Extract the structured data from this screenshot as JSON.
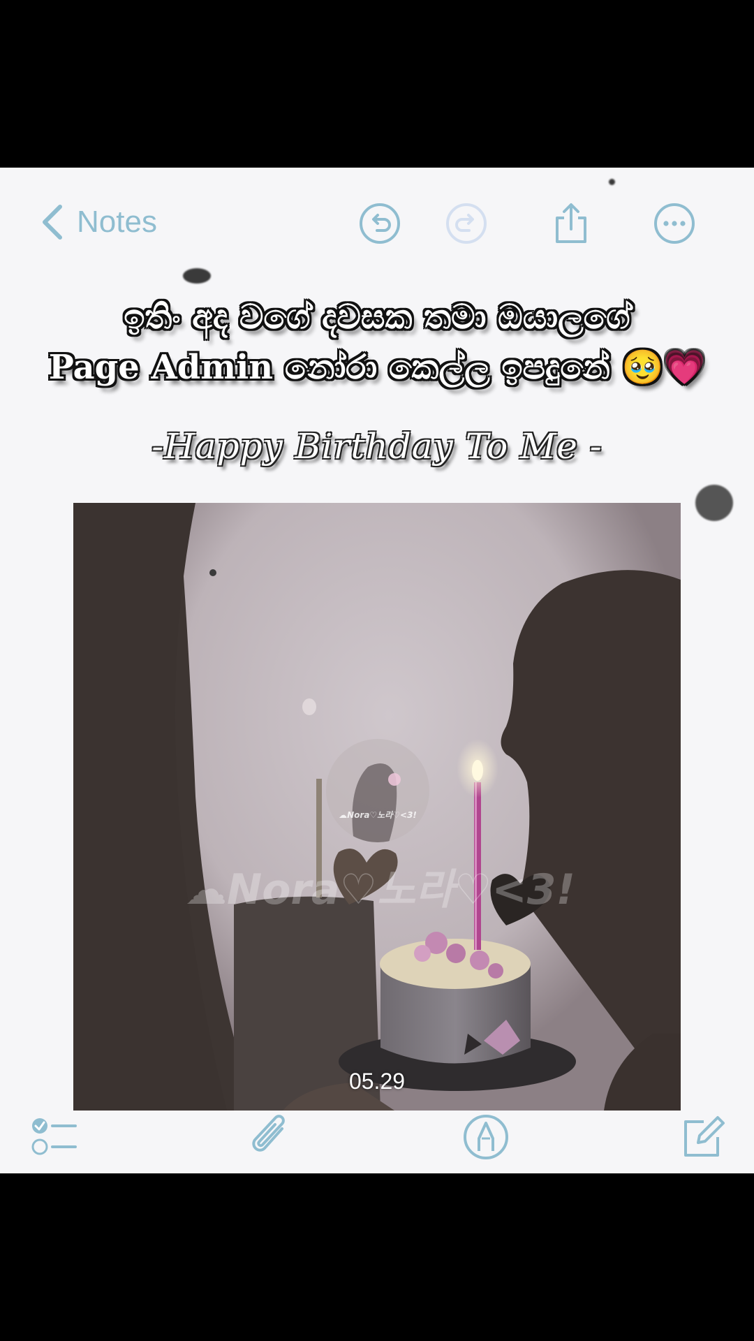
{
  "nav": {
    "back_label": "Notes"
  },
  "caption": {
    "line1": "ඉතිං අද වගේ දවසක තමා ඔයාලගේ",
    "line2": "Page Admin නෝරා කෙල්ල ඉපදුනේ 🥹💗"
  },
  "script_title": "-Happy Birthday To Me -",
  "photo": {
    "watermark": "☁Nora♡노라♡<3!",
    "avatar_label": "☁Nora♡노라♡<3!",
    "timestamp": "05.29"
  },
  "icons": {
    "top": [
      "chevron-left-icon",
      "undo-icon",
      "redo-icon",
      "share-icon",
      "more-icon"
    ],
    "bottom": [
      "checklist-icon",
      "paperclip-icon",
      "markup-pen-icon",
      "compose-icon"
    ]
  },
  "colors": {
    "accent": "#8fbdd0",
    "note_background": "#f6f6f8",
    "letterbox": "#000000"
  }
}
